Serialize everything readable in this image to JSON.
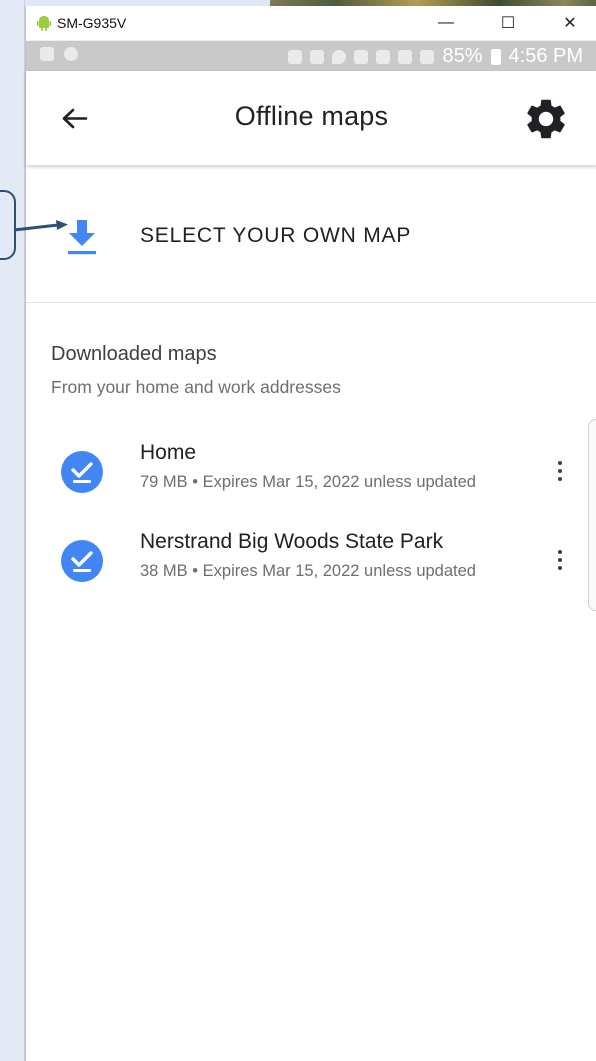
{
  "window": {
    "device_name": "SM-G935V",
    "minimize_label": "—",
    "maximize_label": "☐",
    "close_label": "✕"
  },
  "status_bar": {
    "battery_percent": "85%",
    "time": "4:56 PM"
  },
  "app_bar": {
    "title": "Offline maps"
  },
  "select_map": {
    "label": "SELECT YOUR OWN MAP"
  },
  "downloaded": {
    "title": "Downloaded maps",
    "subtitle": "From your home and work addresses",
    "items": [
      {
        "name": "Home",
        "meta": "79 MB • Expires Mar 15, 2022 unless updated"
      },
      {
        "name": "Nerstrand Big Woods State Park",
        "meta": "38 MB • Expires Mar 15, 2022 unless updated"
      }
    ]
  },
  "icons": {
    "back": "arrow-back-icon",
    "settings": "gear-icon",
    "download": "download-icon",
    "check": "check-circle-icon",
    "more": "more-vert-icon",
    "android": "android-icon"
  },
  "colors": {
    "accent_blue": "#4285f4",
    "status_bar_bg": "#c9c9c9",
    "callout_border": "#2f4f77"
  }
}
